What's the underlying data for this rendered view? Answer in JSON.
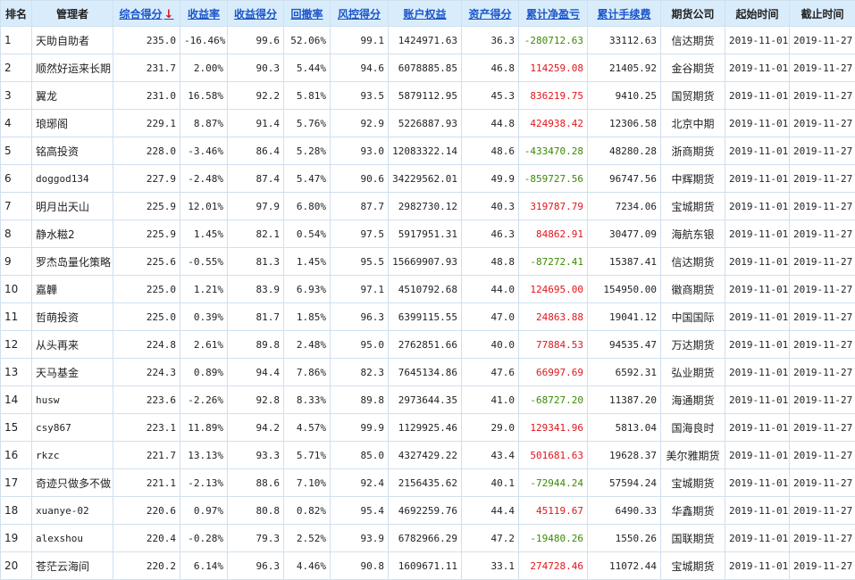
{
  "columns": [
    {
      "key": "rank",
      "label": "排名",
      "link": false
    },
    {
      "key": "manager",
      "label": "管理者",
      "link": false
    },
    {
      "key": "score",
      "label": "综合得分",
      "link": true,
      "sort_icon": "↓"
    },
    {
      "key": "return_rate",
      "label": "收益率",
      "link": true
    },
    {
      "key": "return_score",
      "label": "收益得分",
      "link": true
    },
    {
      "key": "drawdown",
      "label": "回撤率",
      "link": true
    },
    {
      "key": "risk_score",
      "label": "风控得分",
      "link": true
    },
    {
      "key": "equity",
      "label": "账户权益",
      "link": true
    },
    {
      "key": "asset_score",
      "label": "资产得分",
      "link": true
    },
    {
      "key": "net_pnl",
      "label": "累计净盈亏",
      "link": true
    },
    {
      "key": "fees",
      "label": "累计手续费",
      "link": true
    },
    {
      "key": "company",
      "label": "期货公司",
      "link": false
    },
    {
      "key": "start",
      "label": "起始时间",
      "link": false
    },
    {
      "key": "end",
      "label": "截止时间",
      "link": false
    }
  ],
  "rows": [
    {
      "rank": "1",
      "manager": "天助自助者",
      "score": "235.0",
      "return_rate": "-16.46%",
      "return_score": "99.6",
      "drawdown": "52.06%",
      "risk_score": "99.1",
      "equity": "1424971.63",
      "asset_score": "36.3",
      "net_pnl": "-280712.63",
      "fees": "33112.63",
      "company": "信达期货",
      "start": "2019-11-01",
      "end": "2019-11-27"
    },
    {
      "rank": "2",
      "manager": "顺然好运来长期",
      "score": "231.7",
      "return_rate": "2.00%",
      "return_score": "90.3",
      "drawdown": "5.44%",
      "risk_score": "94.6",
      "equity": "6078885.85",
      "asset_score": "46.8",
      "net_pnl": "114259.08",
      "fees": "21405.92",
      "company": "金谷期货",
      "start": "2019-11-01",
      "end": "2019-11-27"
    },
    {
      "rank": "3",
      "manager": "翼龙",
      "score": "231.0",
      "return_rate": "16.58%",
      "return_score": "92.2",
      "drawdown": "5.81%",
      "risk_score": "93.5",
      "equity": "5879112.95",
      "asset_score": "45.3",
      "net_pnl": "836219.75",
      "fees": "9410.25",
      "company": "国贸期货",
      "start": "2019-11-01",
      "end": "2019-11-27"
    },
    {
      "rank": "4",
      "manager": "琅琊阁",
      "score": "229.1",
      "return_rate": "8.87%",
      "return_score": "91.4",
      "drawdown": "5.76%",
      "risk_score": "92.9",
      "equity": "5226887.93",
      "asset_score": "44.8",
      "net_pnl": "424938.42",
      "fees": "12306.58",
      "company": "北京中期",
      "start": "2019-11-01",
      "end": "2019-11-27"
    },
    {
      "rank": "5",
      "manager": "铭高投资",
      "score": "228.0",
      "return_rate": "-3.46%",
      "return_score": "86.4",
      "drawdown": "5.28%",
      "risk_score": "93.0",
      "equity": "12083322.14",
      "asset_score": "48.6",
      "net_pnl": "-433470.28",
      "fees": "48280.28",
      "company": "浙商期货",
      "start": "2019-11-01",
      "end": "2019-11-27"
    },
    {
      "rank": "6",
      "manager": "doggod134",
      "score": "227.9",
      "return_rate": "-2.48%",
      "return_score": "87.4",
      "drawdown": "5.47%",
      "risk_score": "90.6",
      "equity": "34229562.01",
      "asset_score": "49.9",
      "net_pnl": "-859727.56",
      "fees": "96747.56",
      "company": "中辉期货",
      "start": "2019-11-01",
      "end": "2019-11-27"
    },
    {
      "rank": "7",
      "manager": "明月出天山",
      "score": "225.9",
      "return_rate": "12.01%",
      "return_score": "97.9",
      "drawdown": "6.80%",
      "risk_score": "87.7",
      "equity": "2982730.12",
      "asset_score": "40.3",
      "net_pnl": "319787.79",
      "fees": "7234.06",
      "company": "宝城期货",
      "start": "2019-11-01",
      "end": "2019-11-27"
    },
    {
      "rank": "8",
      "manager": "静水糍2",
      "score": "225.9",
      "return_rate": "1.45%",
      "return_score": "82.1",
      "drawdown": "0.54%",
      "risk_score": "97.5",
      "equity": "5917951.31",
      "asset_score": "46.3",
      "net_pnl": "84862.91",
      "fees": "30477.09",
      "company": "海航东银",
      "start": "2019-11-01",
      "end": "2019-11-27"
    },
    {
      "rank": "9",
      "manager": "罗杰岛量化策略",
      "score": "225.6",
      "return_rate": "-0.55%",
      "return_score": "81.3",
      "drawdown": "1.45%",
      "risk_score": "95.5",
      "equity": "15669907.93",
      "asset_score": "48.8",
      "net_pnl": "-87272.41",
      "fees": "15387.41",
      "company": "信达期货",
      "start": "2019-11-01",
      "end": "2019-11-27"
    },
    {
      "rank": "10",
      "manager": "嘉韡",
      "score": "225.0",
      "return_rate": "1.21%",
      "return_score": "83.9",
      "drawdown": "6.93%",
      "risk_score": "97.1",
      "equity": "4510792.68",
      "asset_score": "44.0",
      "net_pnl": "124695.00",
      "fees": "154950.00",
      "company": "徽商期货",
      "start": "2019-11-01",
      "end": "2019-11-27"
    },
    {
      "rank": "11",
      "manager": "哲萌投资",
      "score": "225.0",
      "return_rate": "0.39%",
      "return_score": "81.7",
      "drawdown": "1.85%",
      "risk_score": "96.3",
      "equity": "6399115.55",
      "asset_score": "47.0",
      "net_pnl": "24863.88",
      "fees": "19041.12",
      "company": "中国国际",
      "start": "2019-11-01",
      "end": "2019-11-27"
    },
    {
      "rank": "12",
      "manager": "从头再来",
      "score": "224.8",
      "return_rate": "2.61%",
      "return_score": "89.8",
      "drawdown": "2.48%",
      "risk_score": "95.0",
      "equity": "2762851.66",
      "asset_score": "40.0",
      "net_pnl": "77884.53",
      "fees": "94535.47",
      "company": "万达期货",
      "start": "2019-11-01",
      "end": "2019-11-27"
    },
    {
      "rank": "13",
      "manager": "天马基金",
      "score": "224.3",
      "return_rate": "0.89%",
      "return_score": "94.4",
      "drawdown": "7.86%",
      "risk_score": "82.3",
      "equity": "7645134.86",
      "asset_score": "47.6",
      "net_pnl": "66997.69",
      "fees": "6592.31",
      "company": "弘业期货",
      "start": "2019-11-01",
      "end": "2019-11-27"
    },
    {
      "rank": "14",
      "manager": "husw",
      "score": "223.6",
      "return_rate": "-2.26%",
      "return_score": "92.8",
      "drawdown": "8.33%",
      "risk_score": "89.8",
      "equity": "2973644.35",
      "asset_score": "41.0",
      "net_pnl": "-68727.20",
      "fees": "11387.20",
      "company": "海通期货",
      "start": "2019-11-01",
      "end": "2019-11-27"
    },
    {
      "rank": "15",
      "manager": "csy867",
      "score": "223.1",
      "return_rate": "11.89%",
      "return_score": "94.2",
      "drawdown": "4.57%",
      "risk_score": "99.9",
      "equity": "1129925.46",
      "asset_score": "29.0",
      "net_pnl": "129341.96",
      "fees": "5813.04",
      "company": "国海良时",
      "start": "2019-11-01",
      "end": "2019-11-27"
    },
    {
      "rank": "16",
      "manager": "rkzc",
      "score": "221.7",
      "return_rate": "13.13%",
      "return_score": "93.3",
      "drawdown": "5.71%",
      "risk_score": "85.0",
      "equity": "4327429.22",
      "asset_score": "43.4",
      "net_pnl": "501681.63",
      "fees": "19628.37",
      "company": "美尔雅期货",
      "start": "2019-11-01",
      "end": "2019-11-27"
    },
    {
      "rank": "17",
      "manager": "奇迹只做多不做",
      "score": "221.1",
      "return_rate": "-2.13%",
      "return_score": "88.6",
      "drawdown": "7.10%",
      "risk_score": "92.4",
      "equity": "2156435.62",
      "asset_score": "40.1",
      "net_pnl": "-72944.24",
      "fees": "57594.24",
      "company": "宝城期货",
      "start": "2019-11-01",
      "end": "2019-11-27"
    },
    {
      "rank": "18",
      "manager": "xuanye-02",
      "score": "220.6",
      "return_rate": "0.97%",
      "return_score": "80.8",
      "drawdown": "0.82%",
      "risk_score": "95.4",
      "equity": "4692259.76",
      "asset_score": "44.4",
      "net_pnl": "45119.67",
      "fees": "6490.33",
      "company": "华鑫期货",
      "start": "2019-11-01",
      "end": "2019-11-27"
    },
    {
      "rank": "19",
      "manager": "alexshou",
      "score": "220.4",
      "return_rate": "-0.28%",
      "return_score": "79.3",
      "drawdown": "2.52%",
      "risk_score": "93.9",
      "equity": "6782966.29",
      "asset_score": "47.2",
      "net_pnl": "-19480.26",
      "fees": "1550.26",
      "company": "国联期货",
      "start": "2019-11-01",
      "end": "2019-11-27"
    },
    {
      "rank": "20",
      "manager": "苍茫云海间",
      "score": "220.2",
      "return_rate": "6.14%",
      "return_score": "96.3",
      "drawdown": "4.46%",
      "risk_score": "90.8",
      "equity": "1609671.11",
      "asset_score": "33.1",
      "net_pnl": "274728.46",
      "fees": "11072.44",
      "company": "宝城期货",
      "start": "2019-11-01",
      "end": "2019-11-27"
    }
  ],
  "colors": {
    "positive": "#e0151b",
    "negative": "#3a8a00",
    "link": "#1a55c9",
    "header_bg": "#d9ecfb"
  }
}
